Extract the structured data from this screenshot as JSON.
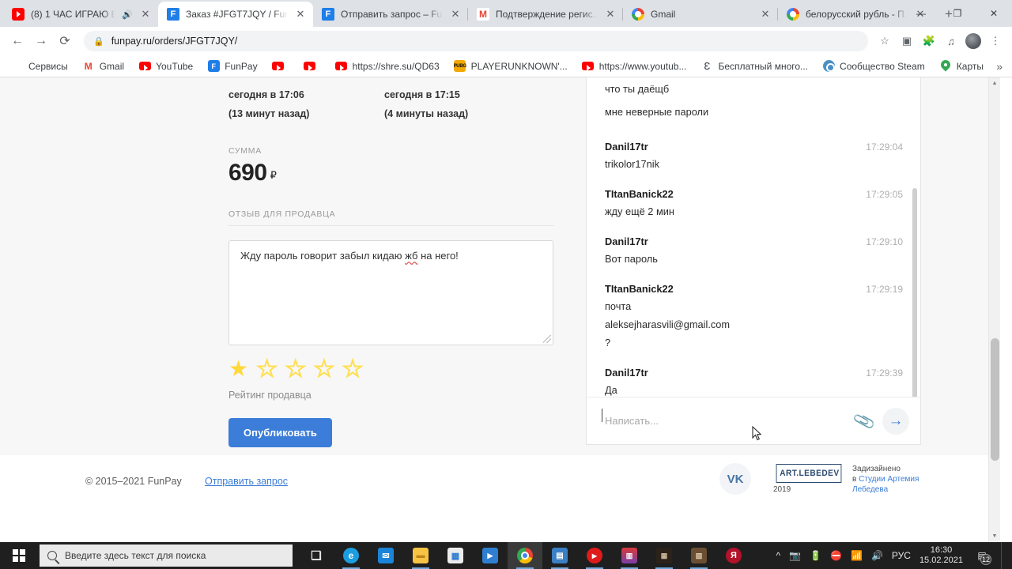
{
  "browser": {
    "tabs": [
      {
        "favicon": "youtube-icon",
        "title": "(8) 1 ЧАС ИГРАЮ В...",
        "muted": true,
        "active": false
      },
      {
        "favicon": "funpay-icon",
        "title": "Заказ #JFGT7JQY / Fun...",
        "muted": false,
        "active": true
      },
      {
        "favicon": "funpay-icon",
        "title": "Отправить запрос – Fu...",
        "muted": false,
        "active": false
      },
      {
        "favicon": "gmail-icon",
        "title": "Подтверждение регис...",
        "muted": false,
        "active": false
      },
      {
        "favicon": "google-icon",
        "title": "Gmail",
        "muted": false,
        "active": false
      },
      {
        "favicon": "google-icon",
        "title": "белорусский рубль - П...",
        "muted": false,
        "active": false
      }
    ],
    "new_tab_label": "+",
    "window_controls": {
      "minimize": "—",
      "maximize": "❐",
      "close": "✕"
    },
    "nav": {
      "back": "←",
      "forward": "→",
      "reload": "⟳"
    },
    "omnibox": {
      "lock_icon": "lock-icon",
      "url": "funpay.ru/orders/JFGT7JQY/"
    },
    "toolbar_icons": [
      "star-icon",
      "cast-icon",
      "extensions-icon",
      "reading-list-icon",
      "profile-avatar",
      "menu-icon"
    ],
    "bookmarks": [
      {
        "icon": "apps-grid-icon",
        "label": "Сервисы"
      },
      {
        "icon": "gmail-icon",
        "label": "Gmail"
      },
      {
        "icon": "youtube-icon",
        "label": "YouTube"
      },
      {
        "icon": "funpay-icon",
        "label": "FunPay"
      },
      {
        "icon": "youtube-icon",
        "label": ""
      },
      {
        "icon": "youtube-icon",
        "label": ""
      },
      {
        "icon": "youtube-icon",
        "label": "https://shre.su/QD63"
      },
      {
        "icon": "pubg-icon",
        "label": "PLAYERUNKNOWN'..."
      },
      {
        "icon": "youtube-icon",
        "label": "https://www.youtub..."
      },
      {
        "icon": "epicgames-icon",
        "label": "Бесплатный мн­ого..."
      },
      {
        "icon": "steam-icon",
        "label": "Сообщество Steam"
      },
      {
        "icon": "maps-pin-icon",
        "label": "Карты"
      }
    ],
    "bookmarks_overflow": "»"
  },
  "order": {
    "date_left": {
      "line1": "сегодня в 17:06",
      "line2": "(13 минут назад)"
    },
    "date_right": {
      "line1": "сегодня в 17:15",
      "line2": "(4 минуты назад)"
    },
    "amount_label": "СУММА",
    "amount_value": "690",
    "currency": "₽",
    "review_label": "ОТЗЫВ ДЛЯ ПРОДАВЦА",
    "review_text_before": "Жду пароль говорит забыл кидаю ",
    "review_text_misspelled": "жб",
    "review_text_after": " на него!",
    "rating_label": "Рейтинг продавца",
    "rating_value": 1,
    "rating_max": 5,
    "publish_button": "Опубликовать"
  },
  "chat": {
    "leading_lines": [
      "что ты даёщб",
      "мне неверные пароли"
    ],
    "messages": [
      {
        "author": "Danil17tr",
        "time": "17:29:04",
        "lines": [
          "trikolor17nik"
        ]
      },
      {
        "author": "TItanBanick22",
        "time": "17:29:05",
        "lines": [
          "жду ещё 2 мин"
        ]
      },
      {
        "author": "Danil17tr",
        "time": "17:29:10",
        "lines": [
          "Вот пароль"
        ]
      },
      {
        "author": "TItanBanick22",
        "time": "17:29:19",
        "lines": [
          "почта",
          "aleksejharasvili@gmail.com",
          "?"
        ]
      },
      {
        "author": "Danil17tr",
        "time": "17:29:39",
        "lines": [
          "Да"
        ]
      }
    ],
    "input_placeholder": "Написать...",
    "attach_icon": "paperclip-icon",
    "send_icon": "send-arrow-icon"
  },
  "footer": {
    "copyright": "© 2015–2021 FunPay",
    "support_link": "Отправить запрос",
    "vk_label": "VK",
    "lebedev_logo": "ART.LEBEDEV",
    "lebedev_year": "2019",
    "designed_line1": "Задизайнено",
    "designed_prefix": "в ",
    "designed_link": "Студии Артемия Лебедева"
  },
  "taskbar": {
    "search_placeholder": "Введите здесь текст для поиска",
    "apps": [
      {
        "name": "task-view-icon",
        "glyph": "❏",
        "color": "#e8e8e8",
        "bg": "transparent",
        "active": false,
        "open": false
      },
      {
        "name": "edge-icon",
        "glyph": "e",
        "color": "#ffffff",
        "bg": "#1b9de2",
        "active": false,
        "open": true
      },
      {
        "name": "mail-icon",
        "glyph": "✉",
        "color": "#ffffff",
        "bg": "#1b84d8",
        "active": false,
        "open": false
      },
      {
        "name": "file-explorer-icon",
        "glyph": "📁",
        "color": "#f6c344",
        "bg": "transparent",
        "active": false,
        "open": true
      },
      {
        "name": "microsoft-store-icon",
        "glyph": "🛍",
        "color": "#ffffff",
        "bg": "#e9e9e9",
        "active": false,
        "open": false
      },
      {
        "name": "movies-tv-icon",
        "glyph": "▶",
        "color": "#ffffff",
        "bg": "#2f7fd0",
        "active": false,
        "open": false
      },
      {
        "name": "chrome-icon",
        "glyph": "◉",
        "color": "#ffffff",
        "bg": "transparent",
        "active": true,
        "open": true
      },
      {
        "name": "powerpoint-icon",
        "glyph": "▤",
        "color": "#ffffff",
        "bg": "#3b7fc4",
        "active": false,
        "open": true
      },
      {
        "name": "youtube-app-icon",
        "glyph": "▶",
        "color": "#ffffff",
        "bg": "#e01b1b",
        "active": false,
        "open": true
      },
      {
        "name": "winrar-icon",
        "glyph": "▥",
        "color": "#ffffff",
        "bg": "#8f4fa0",
        "active": false,
        "open": true
      },
      {
        "name": "game-app-icon",
        "glyph": "▦",
        "color": "#cbb89a",
        "bg": "#2b2219",
        "active": false,
        "open": true
      },
      {
        "name": "game2-app-icon",
        "glyph": "▧",
        "color": "#d8c0a0",
        "bg": "#6b4e34",
        "active": false,
        "open": true
      },
      {
        "name": "yandex-icon",
        "glyph": "Я",
        "color": "#ffffff",
        "bg": "#b3122a",
        "active": false,
        "open": false
      }
    ],
    "tray": {
      "chevron": "^",
      "icons": [
        "camera-icon",
        "battery-icon",
        "no-entry-icon",
        "wifi-icon",
        "volume-icon"
      ],
      "language": "РУС",
      "time": "16:30",
      "date": "15.02.2021",
      "notification_count": "12"
    }
  }
}
